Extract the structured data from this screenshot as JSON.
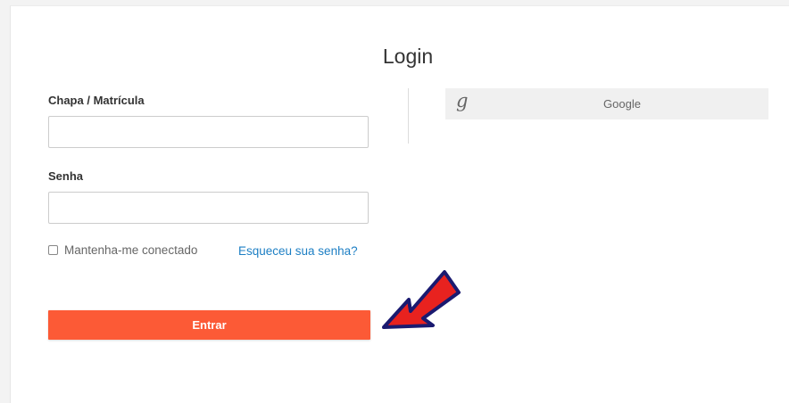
{
  "login_form": {
    "title": "Login",
    "id_label": "Chapa / Matrícula",
    "id_value": "",
    "password_label": "Senha",
    "password_value": "",
    "remember_label": "Mantenha-me conectado",
    "remember_checked": false,
    "forgot_link": "Esqueceu sua senha?",
    "submit_label": "Entrar"
  },
  "social": {
    "google_icon_glyph": "g",
    "google_label": "Google"
  },
  "icons": {
    "google": "google-g-icon",
    "annotation": "red-arrow-pointer-icon"
  },
  "colors": {
    "submit_button": "#fc5a36",
    "link": "#1d7fc4",
    "annotation_arrow_fill": "#e8221f",
    "annotation_arrow_outline": "#1a1a70"
  }
}
